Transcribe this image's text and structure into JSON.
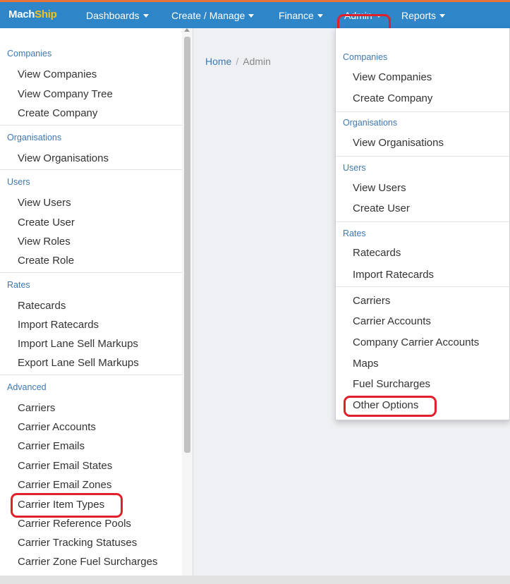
{
  "brand": {
    "part1": "Mach",
    "part2": "Ship"
  },
  "nav": {
    "dashboards": "Dashboards",
    "create_manage": "Create / Manage",
    "finance": "Finance",
    "admin": "Admin",
    "reports": "Reports"
  },
  "breadcrumb": {
    "home": "Home",
    "separator": "/",
    "current": "Admin"
  },
  "sidebar": {
    "companies_h": "Companies",
    "view_companies": "View Companies",
    "view_company_tree": "View Company Tree",
    "create_company": "Create Company",
    "organisations_h": "Organisations",
    "view_organisations": "View Organisations",
    "users_h": "Users",
    "view_users": "View Users",
    "create_user": "Create User",
    "view_roles": "View Roles",
    "create_role": "Create Role",
    "rates_h": "Rates",
    "ratecards": "Ratecards",
    "import_ratecards": "Import Ratecards",
    "import_lane_sell_markups": "Import Lane Sell Markups",
    "export_lane_sell_markups": "Export Lane Sell Markups",
    "advanced_h": "Advanced",
    "carriers": "Carriers",
    "carrier_accounts": "Carrier Accounts",
    "carrier_emails": "Carrier Emails",
    "carrier_email_states": "Carrier Email States",
    "carrier_email_zones": "Carrier Email Zones",
    "carrier_item_types": "Carrier Item Types",
    "carrier_reference_pools": "Carrier Reference Pools",
    "carrier_tracking_statuses": "Carrier Tracking Statuses",
    "carrier_zone_fuel_surcharges": "Carrier Zone Fuel Surcharges"
  },
  "dropdown": {
    "companies_h": "Companies",
    "view_companies": "View Companies",
    "create_company": "Create Company",
    "organisations_h": "Organisations",
    "view_organisations": "View Organisations",
    "users_h": "Users",
    "view_users": "View Users",
    "create_user": "Create User",
    "rates_h": "Rates",
    "ratecards": "Ratecards",
    "import_ratecards": "Import Ratecards",
    "carriers": "Carriers",
    "carrier_accounts": "Carrier Accounts",
    "company_carrier_accounts": "Company Carrier Accounts",
    "maps": "Maps",
    "fuel_surcharges": "Fuel Surcharges",
    "other_options": "Other Options"
  },
  "colors": {
    "navbar": "#2e86c9",
    "accent_stripe": "#e8733a",
    "brand_highlight": "#f4c21b",
    "link": "#3c78b4",
    "highlight_ring": "#e0202a"
  }
}
